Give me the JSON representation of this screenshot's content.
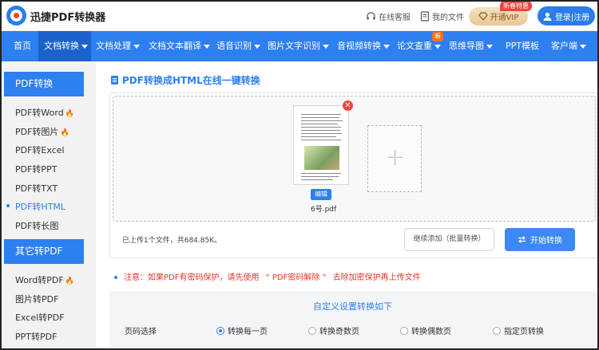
{
  "header": {
    "brand": "迅捷PDF转换器",
    "service": "在线客服",
    "my_files": "我的文件",
    "vip_badge": "新春特惠",
    "vip": "开通VIP",
    "login": "登录|注册"
  },
  "nav": {
    "items": [
      {
        "label": "首页",
        "caret": false
      },
      {
        "label": "文档转换",
        "caret": true
      },
      {
        "label": "文档处理",
        "caret": true
      },
      {
        "label": "文档文本翻译",
        "caret": true
      },
      {
        "label": "语音识别",
        "caret": true
      },
      {
        "label": "图片文字识别",
        "caret": true
      },
      {
        "label": "音视频转换",
        "caret": true
      },
      {
        "label": "论文查重",
        "caret": true
      },
      {
        "label": "思维导图",
        "caret": true
      },
      {
        "label": "PPT模板",
        "caret": false
      },
      {
        "label": "客户端",
        "caret": true
      }
    ],
    "new_badge": "新"
  },
  "sidebar": {
    "group1": "PDF转换",
    "items1": [
      "PDF转Word",
      "PDF转图片",
      "PDF转Excel",
      "PDF转PPT",
      "PDF转TXT",
      "PDF转HTML",
      "PDF转长图"
    ],
    "group2": "其它转PDF",
    "items2": [
      "Word转PDF",
      "图片转PDF",
      "Excel转PDF",
      "PPT转PDF"
    ]
  },
  "main": {
    "title": "PDF转换成HTML在线一键转换",
    "edit": "编辑",
    "filename": "6号.pdf",
    "uploaded": "已上传1个文件，共684.85K。",
    "continue": "继续添加（批量转换）",
    "start": "开始转换",
    "note_prefix": "注意：如果PDF有密码保护，请先使用",
    "note_link": "“ PDF密码解除 ”",
    "note_suffix": "去除加密保护再上传文件",
    "settings_title": "自定义设置转换如下",
    "page_label": "页码选择",
    "options": [
      "转换每一页",
      "转换奇数页",
      "转换偶数页",
      "指定页转换"
    ],
    "selected_option": "转换每一页"
  }
}
